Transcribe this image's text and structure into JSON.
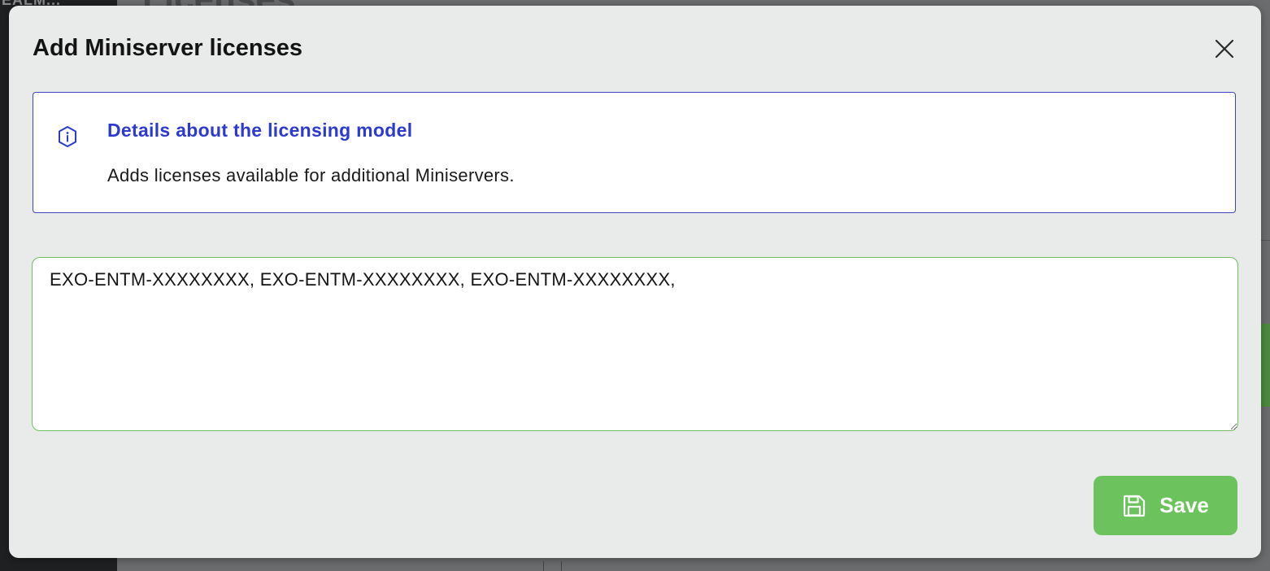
{
  "background": {
    "page_heading": "Licenses",
    "sidebar_text": "EALM..."
  },
  "modal": {
    "title": "Add Miniserver licenses",
    "close_icon": "close-icon"
  },
  "info": {
    "icon": "info-icon",
    "title": "Details about the licensing model",
    "text": "Adds licenses available for additional Miniservers.",
    "accent_color": "#2c3ad0"
  },
  "license_input": {
    "value": "EXO-ENTM-XXXXXXXX, EXO-ENTM-XXXXXXXX, EXO-ENTM-XXXXXXXX, ",
    "border_color": "#6dc05c"
  },
  "save_button": {
    "label": "Save",
    "icon": "floppy-disk-icon",
    "color": "#6cc35d"
  }
}
